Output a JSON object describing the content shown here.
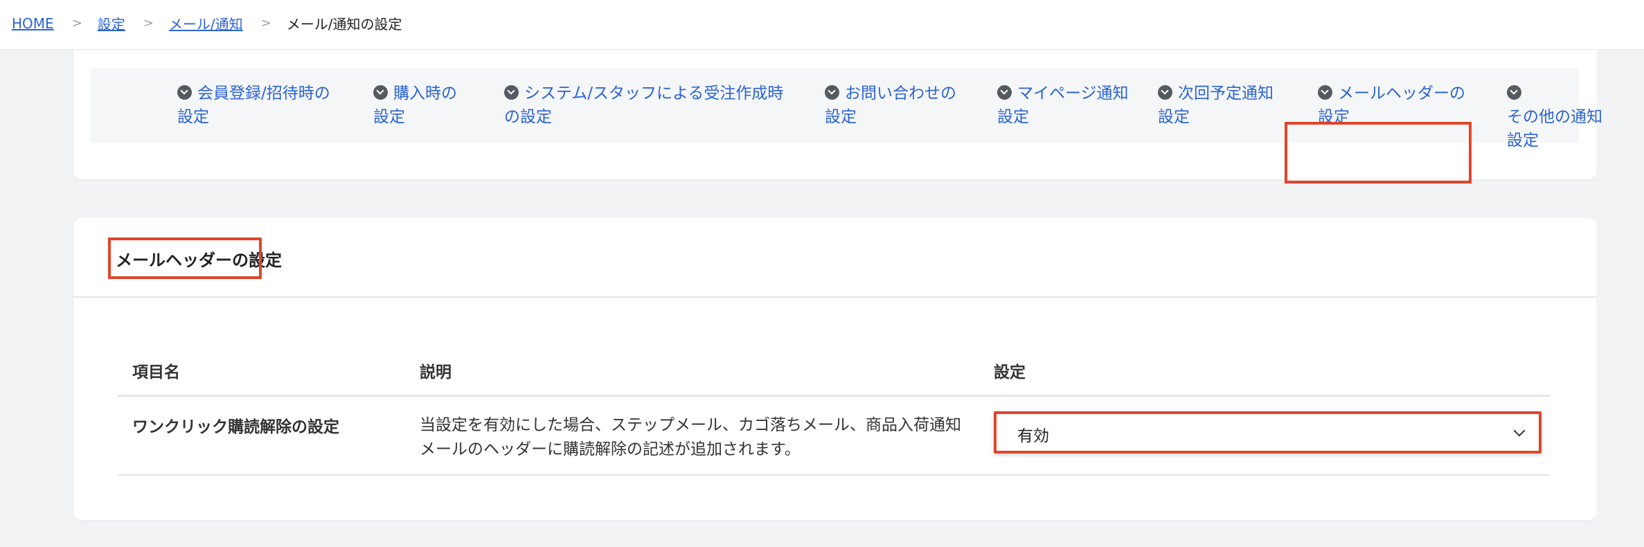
{
  "breadcrumb": {
    "items": [
      "HOME",
      "設定",
      "メール/通知"
    ],
    "separator": ">",
    "current": "メール/通知の設定"
  },
  "nav": {
    "items": [
      {
        "label": "会員登録/招待時の\n設定"
      },
      {
        "label": "購入時の\n設定"
      },
      {
        "label": "システム/スタッフによる受注作成時\nの設定"
      },
      {
        "label": "お問い合わせの\n設定"
      },
      {
        "label": "マイページ通知\n設定"
      },
      {
        "label": "次回予定通知\n設定"
      },
      {
        "label": "メールヘッダーの\n設定"
      },
      {
        "label": "その他の通知\n設定"
      }
    ]
  },
  "section": {
    "title": "メールヘッダーの設定",
    "columns": [
      "項目名",
      "説明",
      "設定"
    ],
    "row": {
      "name": "ワンクリック購読解除の設定",
      "description": "当設定を有効にした場合、ステップメール、カゴ落ちメール、商品入荷通知メールのヘッダーに購読解除の記述が追加されます。",
      "select_value": "有効"
    }
  },
  "colors": {
    "link": "#2a63d4",
    "highlight": "#e0452a",
    "background": "#f2f3f5"
  }
}
